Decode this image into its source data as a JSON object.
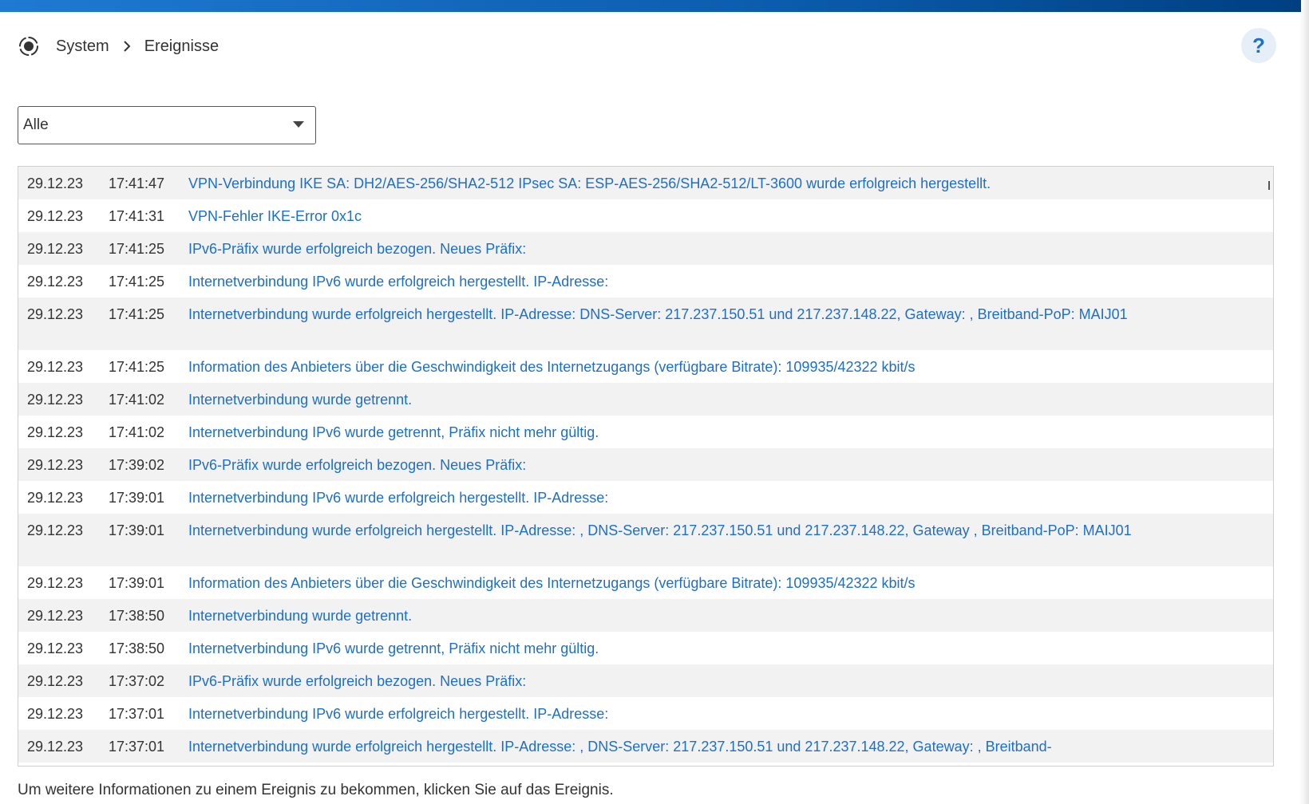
{
  "breadcrumb": {
    "icon": "radio-target-icon",
    "section": "System",
    "page": "Ereignisse"
  },
  "help": {
    "label": "?"
  },
  "filter": {
    "selected": "Alle"
  },
  "events": [
    {
      "date": "29.12.23",
      "time": "17:41:47",
      "message": "VPN-Verbindung IKE SA: DH2/AES-256/SHA2-512 IPsec SA: ESP-AES-256/SHA2-512/LT-3600 wurde erfolgreich hergestellt."
    },
    {
      "date": "29.12.23",
      "time": "17:41:31",
      "message": "VPN-Fehler IKE-Error 0x1c"
    },
    {
      "date": "29.12.23",
      "time": "17:41:25",
      "message": "IPv6-Präfix wurde erfolgreich bezogen. Neues Präfix:"
    },
    {
      "date": "29.12.23",
      "time": "17:41:25",
      "message": "Internetverbindung IPv6 wurde erfolgreich hergestellt. IP-Adresse:"
    },
    {
      "date": "29.12.23",
      "time": "17:41:25",
      "message": "Internetverbindung wurde erfolgreich hergestellt. IP-Adresse: DNS-Server: 217.237.150.51 und 217.237.148.22, Gateway: , Breitband-PoP: MAIJ01"
    },
    {
      "date": "29.12.23",
      "time": "17:41:25",
      "message": "Information des Anbieters über die Geschwindigkeit des Internetzugangs (verfügbare Bitrate): 109935/42322 kbit/s"
    },
    {
      "date": "29.12.23",
      "time": "17:41:02",
      "message": "Internetverbindung wurde getrennt."
    },
    {
      "date": "29.12.23",
      "time": "17:41:02",
      "message": "Internetverbindung IPv6 wurde getrennt, Präfix nicht mehr gültig."
    },
    {
      "date": "29.12.23",
      "time": "17:39:02",
      "message": "IPv6-Präfix wurde erfolgreich bezogen. Neues Präfix:"
    },
    {
      "date": "29.12.23",
      "time": "17:39:01",
      "message": "Internetverbindung IPv6 wurde erfolgreich hergestellt. IP-Adresse:"
    },
    {
      "date": "29.12.23",
      "time": "17:39:01",
      "message": "Internetverbindung wurde erfolgreich hergestellt. IP-Adresse: , DNS-Server: 217.237.150.51 und 217.237.148.22, Gateway , Breitband-PoP: MAIJ01"
    },
    {
      "date": "29.12.23",
      "time": "17:39:01",
      "message": "Information des Anbieters über die Geschwindigkeit des Internetzugangs (verfügbare Bitrate): 109935/42322 kbit/s"
    },
    {
      "date": "29.12.23",
      "time": "17:38:50",
      "message": "Internetverbindung wurde getrennt."
    },
    {
      "date": "29.12.23",
      "time": "17:38:50",
      "message": "Internetverbindung IPv6 wurde getrennt, Präfix nicht mehr gültig."
    },
    {
      "date": "29.12.23",
      "time": "17:37:02",
      "message": "IPv6-Präfix wurde erfolgreich bezogen. Neues Präfix:"
    },
    {
      "date": "29.12.23",
      "time": "17:37:01",
      "message": "Internetverbindung IPv6 wurde erfolgreich hergestellt. IP-Adresse:"
    },
    {
      "date": "29.12.23",
      "time": "17:37:01",
      "message": "Internetverbindung wurde erfolgreich hergestellt. IP-Adresse: , DNS-Server: 217.237.150.51 und 217.237.148.22, Gateway: , Breitband-"
    }
  ],
  "footer": {
    "note": "Um weitere Informationen zu einem Ereignis zu bekommen, klicken Sie auf das Ereignis."
  },
  "colors": {
    "link": "#1e6fc8",
    "header_bar": "#0b5cad",
    "row_alt": "#f2f2f2"
  }
}
